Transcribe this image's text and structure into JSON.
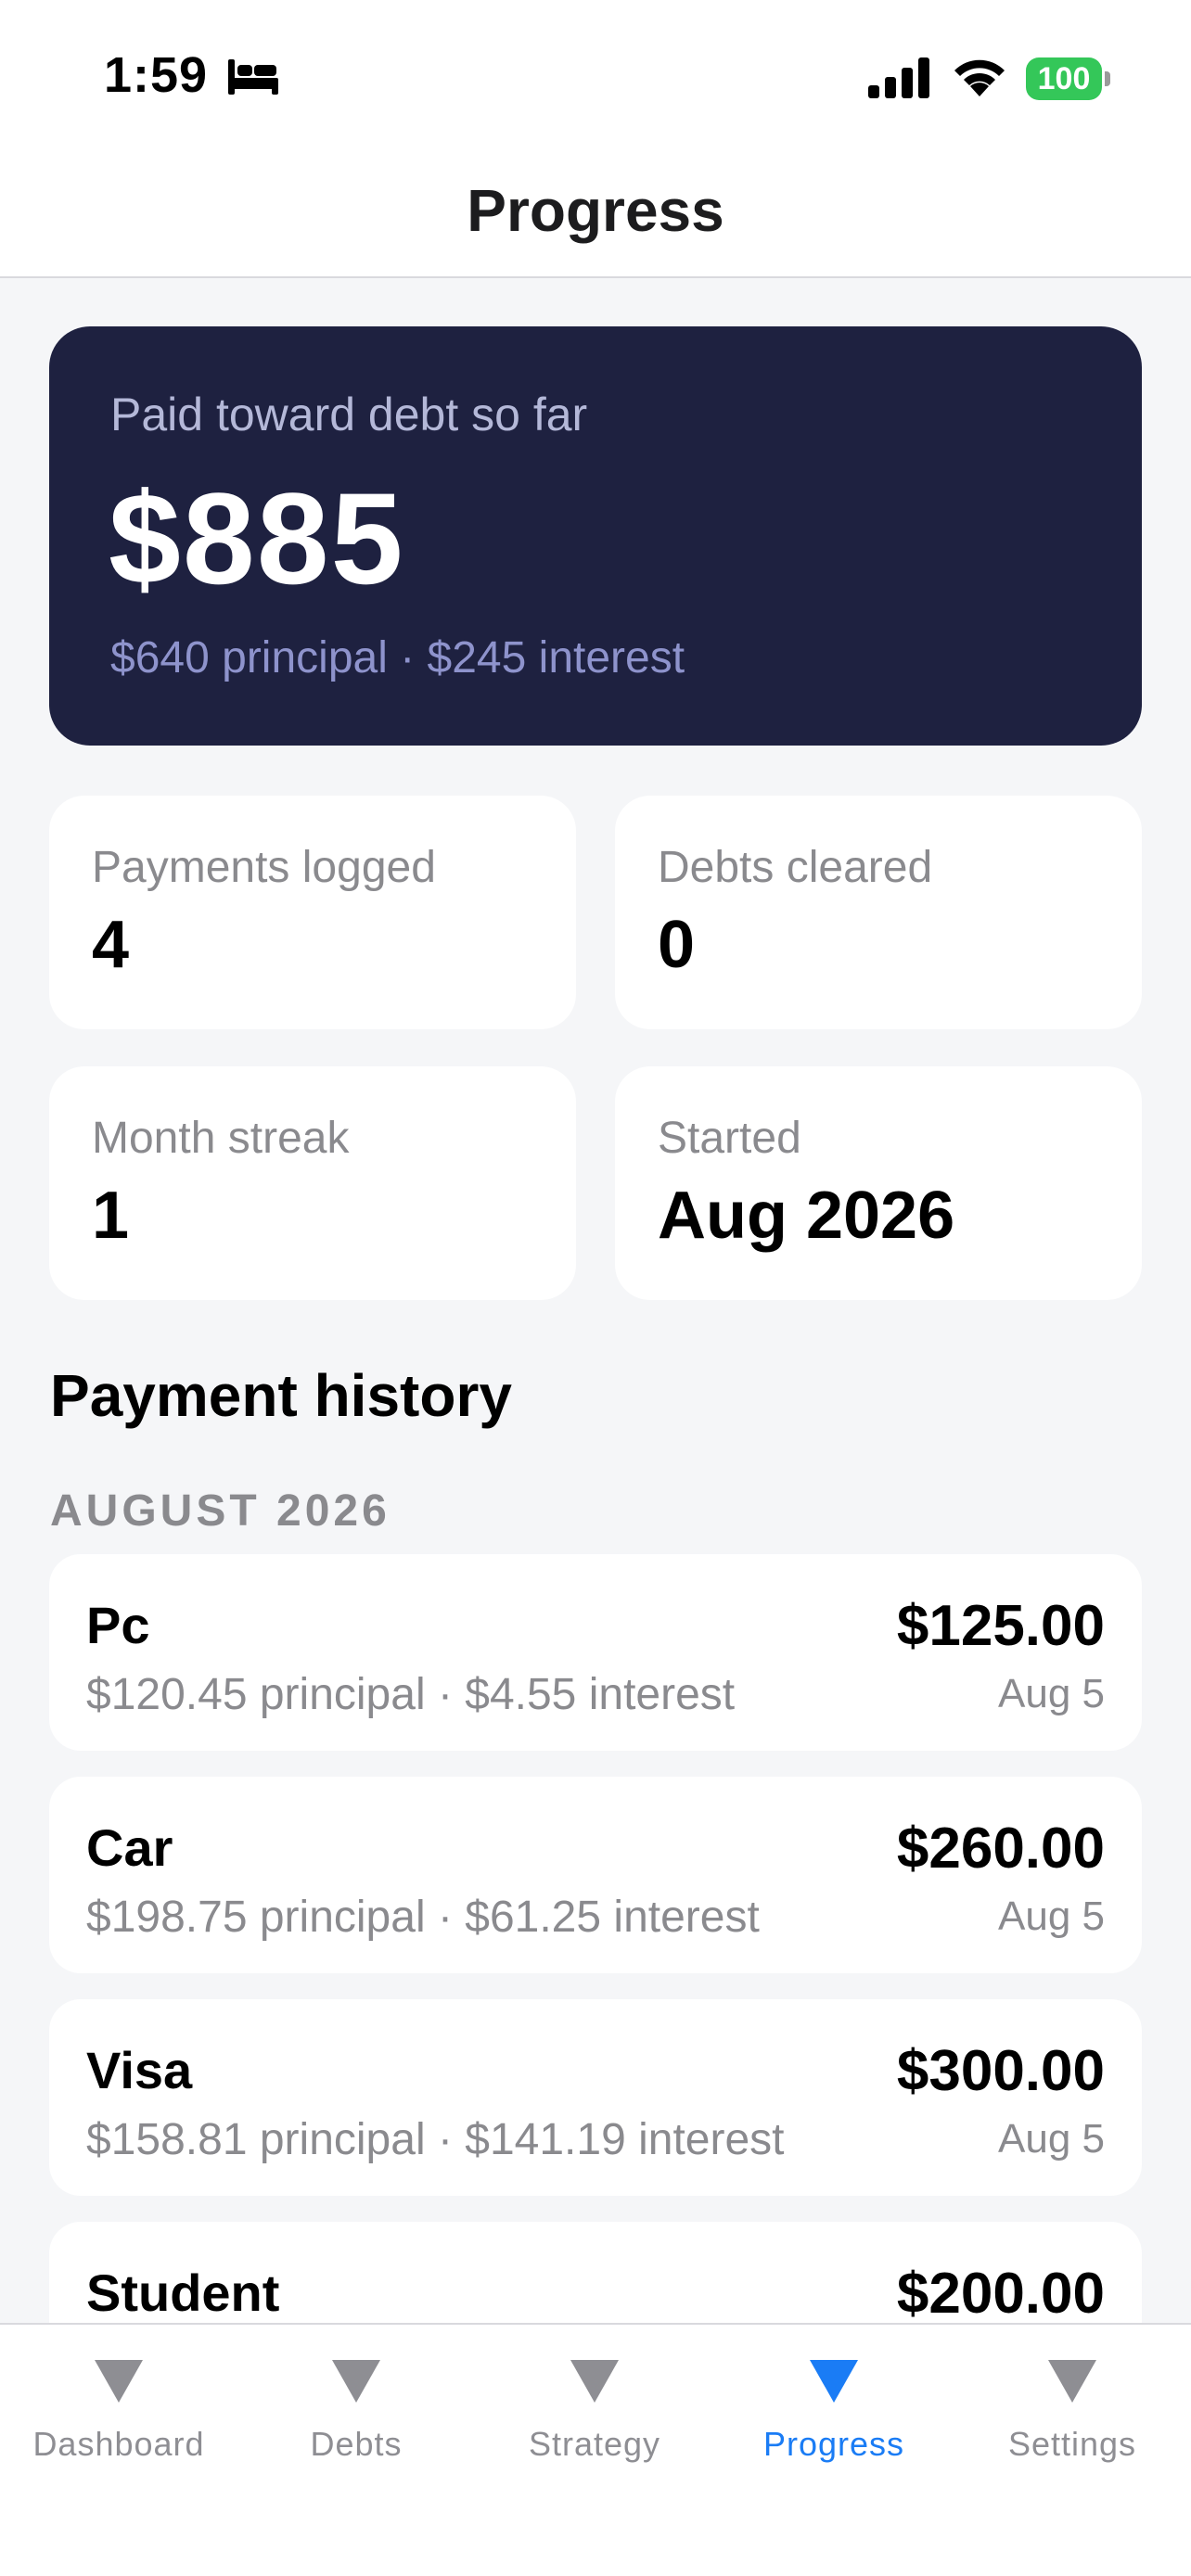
{
  "status_bar": {
    "time": "1:59",
    "battery": "100",
    "battery_color": "#34c759"
  },
  "nav": {
    "title": "Progress"
  },
  "summary": {
    "label": "Paid toward debt so far",
    "amount": "$885",
    "breakdown": "$640 principal · $245 interest"
  },
  "stats": [
    {
      "label": "Payments logged",
      "value": "4"
    },
    {
      "label": "Debts cleared",
      "value": "0"
    },
    {
      "label": "Month streak",
      "value": "1"
    },
    {
      "label": "Started",
      "value": "Aug 2026"
    }
  ],
  "history": {
    "title": "Payment history",
    "month": "AUGUST 2026",
    "payments": [
      {
        "name": "Pc",
        "detail": "$120.45 principal · $4.55 interest",
        "amount": "$125.00",
        "date": "Aug 5"
      },
      {
        "name": "Car",
        "detail": "$198.75 principal · $61.25 interest",
        "amount": "$260.00",
        "date": "Aug 5"
      },
      {
        "name": "Visa",
        "detail": "$158.81 principal · $141.19 interest",
        "amount": "$300.00",
        "date": "Aug 5"
      },
      {
        "name": "Student",
        "detail": "",
        "amount": "$200.00",
        "date": ""
      }
    ]
  },
  "tabs": [
    {
      "label": "Dashboard",
      "icon": "triangle-icon",
      "active": false
    },
    {
      "label": "Debts",
      "icon": "triangle-icon",
      "active": false
    },
    {
      "label": "Strategy",
      "icon": "triangle-icon",
      "active": false
    },
    {
      "label": "Progress",
      "icon": "triangle-icon",
      "active": true
    },
    {
      "label": "Settings",
      "icon": "triangle-icon",
      "active": false
    }
  ],
  "colors": {
    "hero_background": "#1e2140",
    "accent": "#1a7cf5",
    "inactive_tab": "#8e8e93"
  }
}
